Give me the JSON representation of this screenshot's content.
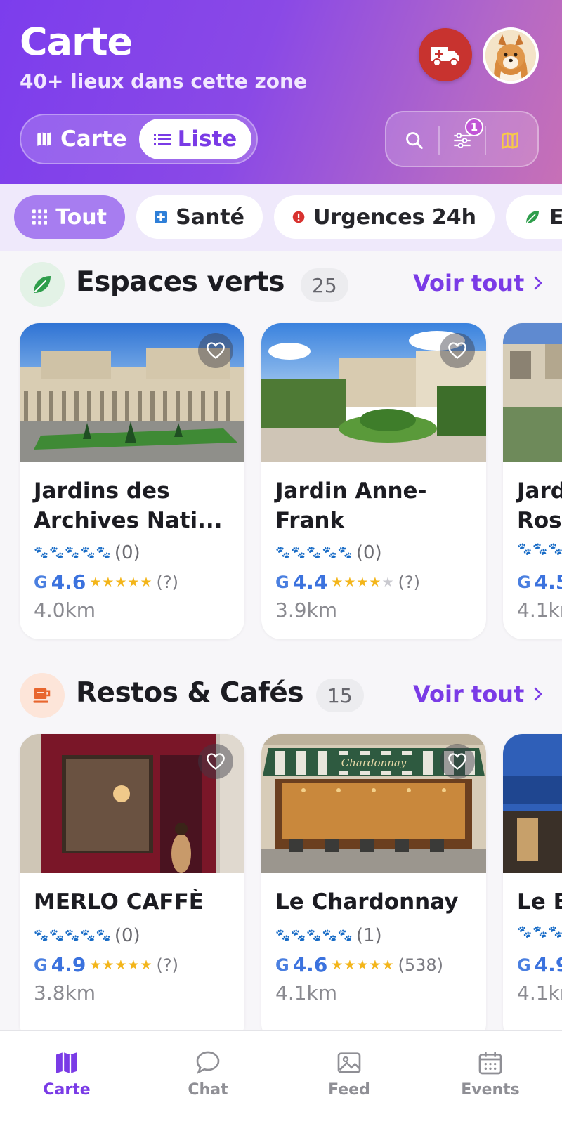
{
  "header": {
    "title": "Carte",
    "subtitle": "40+ lieux dans cette zone",
    "emergency_icon": "ambulance-icon",
    "toggle": {
      "carte_label": "Carte",
      "liste_label": "Liste",
      "selected": "Liste"
    },
    "tools": {
      "filter_badge": "1"
    }
  },
  "chips": [
    {
      "label": "Tout",
      "icon": "grid-icon",
      "active": true
    },
    {
      "label": "Santé",
      "icon": "plus-icon"
    },
    {
      "label": "Urgences 24h",
      "icon": "alert-icon"
    },
    {
      "label": "E",
      "icon": "leaf-icon"
    }
  ],
  "sections": [
    {
      "title": "Espaces verts",
      "count": "25",
      "see_all": "Voir tout",
      "cards": [
        {
          "name": "Jardins des Archives Nati...",
          "paw_count": "(0)",
          "g": "G",
          "g_score": "4.6",
          "g_stars": 5,
          "g_count": "(?)",
          "distance": "4.0km"
        },
        {
          "name": "Jardin Anne-Frank",
          "paw_count": "(0)",
          "g": "G",
          "g_score": "4.4",
          "g_stars": 4,
          "g_count": "(?)",
          "distance": "3.9km"
        },
        {
          "name": "Jard",
          "name2": "Ros",
          "g": "G",
          "g_score": "4.5",
          "distance": "4.1kr"
        }
      ]
    },
    {
      "title": "Restos & Cafés",
      "count": "15",
      "see_all": "Voir tout",
      "cards": [
        {
          "name": "MERLO CAFFÈ",
          "paw_count": "(0)",
          "g": "G",
          "g_score": "4.9",
          "g_stars": 5,
          "g_count": "(?)",
          "distance": "3.8km"
        },
        {
          "name": "Le Chardonnay",
          "paw_count": "(1)",
          "g": "G",
          "g_score": "4.6",
          "g_stars": 5,
          "g_count": "(538)",
          "distance": "4.1km",
          "sign": "Chardonnay"
        },
        {
          "name": "Le B",
          "g": "G",
          "g_score": "4.9",
          "distance": "4.1kr"
        }
      ]
    }
  ],
  "nav": [
    {
      "label": "Carte",
      "icon": "map-icon",
      "active": true
    },
    {
      "label": "Chat",
      "icon": "chat-icon"
    },
    {
      "label": "Feed",
      "icon": "image-icon"
    },
    {
      "label": "Events",
      "icon": "calendar-icon"
    }
  ],
  "colors": {
    "accent": "#7a3be6",
    "emergency": "#c8332f",
    "google_blue": "#3b72de",
    "star": "#f3b51a"
  }
}
